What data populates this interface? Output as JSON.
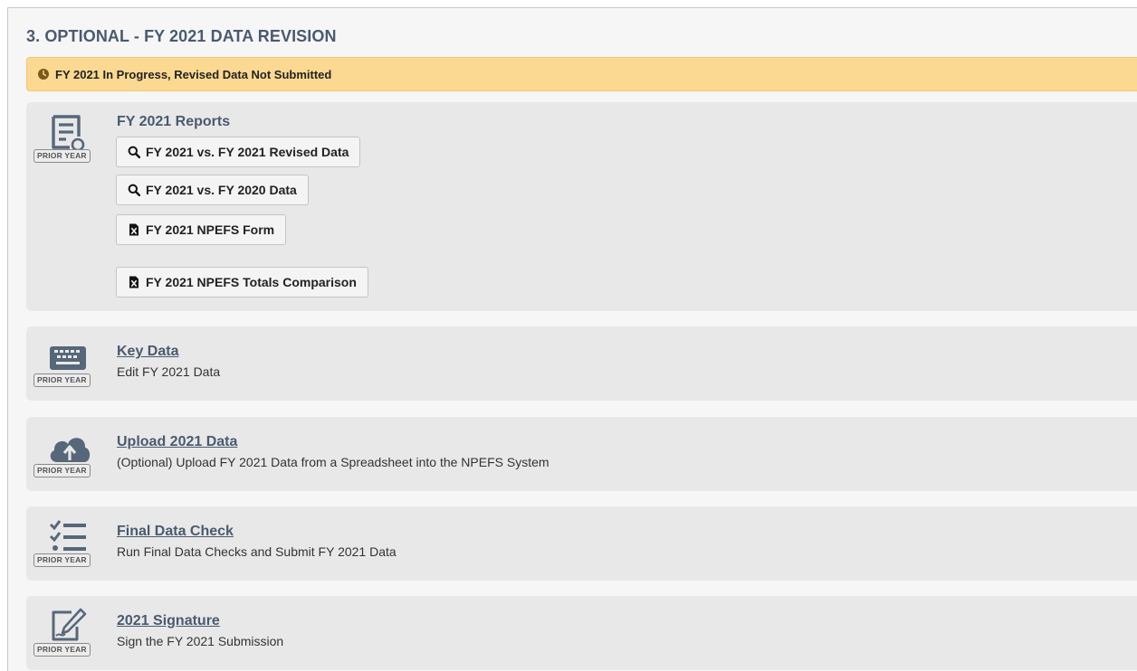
{
  "section": {
    "title": "3. OPTIONAL - FY 2021 DATA REVISION",
    "status": "FY 2021 In Progress, Revised Data Not Submitted",
    "status_icon": "clock-icon",
    "status_color": "#fcd992"
  },
  "badge_label": "PRIOR YEAR",
  "reports": {
    "title": "FY 2021 Reports",
    "icon": "report-document-icon",
    "buttons": [
      {
        "label": "FY 2021 vs. FY 2021 Revised Data",
        "icon": "search-icon"
      },
      {
        "label": "FY 2021 vs. FY 2020 Data",
        "icon": "search-icon"
      },
      {
        "label": "FY 2021 NPEFS Form",
        "icon": "excel-file-icon"
      },
      {
        "label": "FY 2021 NPEFS Totals Comparison",
        "icon": "excel-file-icon"
      }
    ]
  },
  "key_data": {
    "link": "Key Data",
    "desc": "Edit FY 2021 Data",
    "icon": "keyboard-icon"
  },
  "upload": {
    "link": "Upload 2021 Data",
    "desc": "(Optional) Upload FY 2021 Data from a Spreadsheet into the NPEFS System",
    "icon": "cloud-upload-icon"
  },
  "final_check": {
    "link": "Final Data Check",
    "desc": "Run Final Data Checks and Submit FY 2021 Data",
    "icon": "checklist-icon"
  },
  "signature": {
    "link": "2021 Signature",
    "desc": "Sign the FY 2021 Submission",
    "icon": "signature-pen-icon"
  }
}
